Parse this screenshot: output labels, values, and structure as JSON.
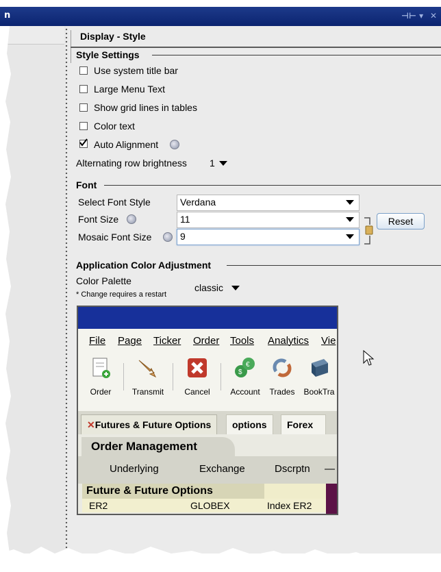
{
  "window": {
    "title": "n",
    "controls": "-⊣⊢ ▾  ×"
  },
  "panel": {
    "heading": "Display - Style"
  },
  "style_settings": {
    "title": "Style Settings",
    "options": [
      {
        "label": "Use system title bar",
        "checked": false
      },
      {
        "label": "Large Menu Text",
        "checked": false
      },
      {
        "label": "Show grid lines in tables",
        "checked": false
      },
      {
        "label": "Color text",
        "checked": false
      },
      {
        "label": "Auto Alignment",
        "checked": true
      }
    ],
    "alt_row_label": "Alternating row brightness",
    "alt_row_value": "1"
  },
  "font": {
    "title": "Font",
    "select_font_style_label": "Select Font Style",
    "select_font_style_value": "Verdana",
    "font_size_label": "Font Size",
    "font_size_value": "11",
    "mosaic_font_size_label": "Mosaic Font Size",
    "mosaic_font_size_value": "9",
    "reset_label": "Reset"
  },
  "color": {
    "title": "Application Color Adjustment",
    "palette_label": "Color Palette",
    "palette_note": "* Change requires a restart",
    "palette_value": "classic"
  },
  "preview": {
    "menu": [
      "File",
      "Page",
      "Ticker",
      "Order",
      "Tools",
      "Analytics",
      "Vie"
    ],
    "tools": [
      "Order",
      "Transmit",
      "Cancel",
      "Account",
      "Trades",
      "BookTra"
    ],
    "tabs": [
      "Futures & Future Options",
      "options",
      "Forex"
    ],
    "section": "Order Management",
    "columns": [
      "Underlying",
      "Exchange",
      "Dscrptn",
      "—"
    ],
    "group": "Future & Future Options",
    "row": {
      "underlying": "ER2",
      "exchange": "GLOBEX",
      "description": "Index ER2"
    }
  },
  "colors": {
    "title_bar": "#0b2470",
    "accent": "#17309a",
    "group_row": "#d7d5b6",
    "purple": "#5c1246"
  }
}
